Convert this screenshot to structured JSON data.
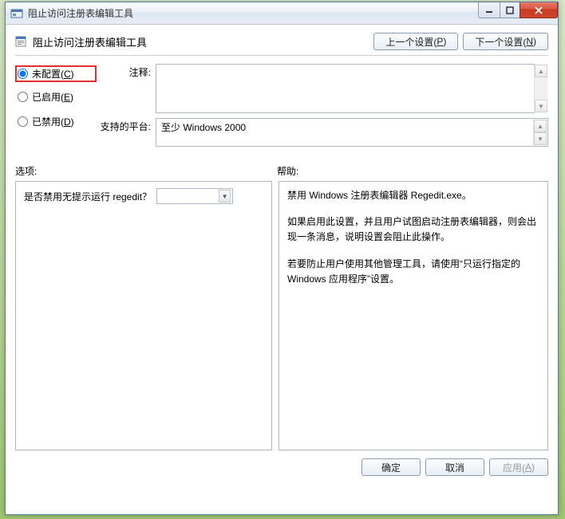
{
  "window": {
    "title": "阻止访问注册表编辑工具"
  },
  "header": {
    "title": "阻止访问注册表编辑工具",
    "prev_btn": "上一个设置(",
    "prev_key": "P",
    "prev_btn_tail": ")",
    "next_btn": "下一个设置(",
    "next_key": "N",
    "next_btn_tail": ")"
  },
  "radios": {
    "not_configured": "未配置(",
    "not_configured_key": "C",
    "enabled": "已启用(",
    "enabled_key": "E",
    "disabled": "已禁用(",
    "disabled_key": "D",
    "tail": ")"
  },
  "meta": {
    "comment_label": "注释:",
    "platform_label": "支持的平台:",
    "platform_value": "至少 Windows 2000"
  },
  "sections": {
    "options_label": "选项:",
    "help_label": "帮助:"
  },
  "options": {
    "question": "是否禁用无提示运行 regedit？"
  },
  "help": {
    "p1": "禁用 Windows 注册表编辑器 Regedit.exe。",
    "p2": "如果启用此设置，并且用户试图启动注册表编辑器，则会出现一条消息，说明设置会阻止此操作。",
    "p3": "若要防止用户使用其他管理工具，请使用“只运行指定的 Windows 应用程序”设置。"
  },
  "footer": {
    "ok": "确定",
    "cancel": "取消",
    "apply": "应用(",
    "apply_key": "A",
    "apply_tail": ")"
  }
}
